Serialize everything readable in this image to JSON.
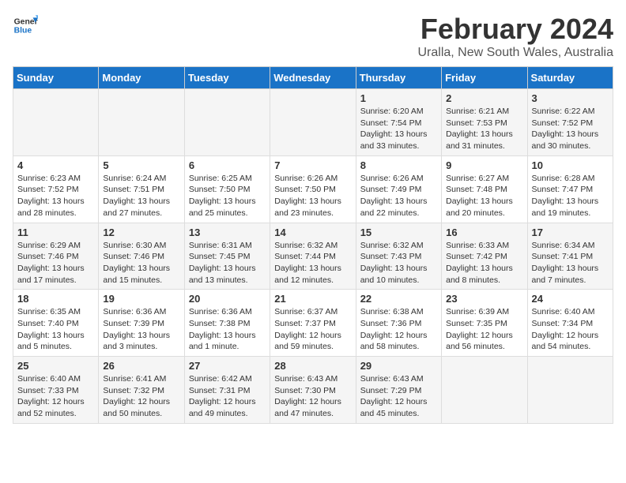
{
  "logo": {
    "line1": "General",
    "line2": "Blue"
  },
  "title": "February 2024",
  "subtitle": "Uralla, New South Wales, Australia",
  "days_header": [
    "Sunday",
    "Monday",
    "Tuesday",
    "Wednesday",
    "Thursday",
    "Friday",
    "Saturday"
  ],
  "weeks": [
    [
      {
        "day": "",
        "info": ""
      },
      {
        "day": "",
        "info": ""
      },
      {
        "day": "",
        "info": ""
      },
      {
        "day": "",
        "info": ""
      },
      {
        "day": "1",
        "info": "Sunrise: 6:20 AM\nSunset: 7:54 PM\nDaylight: 13 hours\nand 33 minutes."
      },
      {
        "day": "2",
        "info": "Sunrise: 6:21 AM\nSunset: 7:53 PM\nDaylight: 13 hours\nand 31 minutes."
      },
      {
        "day": "3",
        "info": "Sunrise: 6:22 AM\nSunset: 7:52 PM\nDaylight: 13 hours\nand 30 minutes."
      }
    ],
    [
      {
        "day": "4",
        "info": "Sunrise: 6:23 AM\nSunset: 7:52 PM\nDaylight: 13 hours\nand 28 minutes."
      },
      {
        "day": "5",
        "info": "Sunrise: 6:24 AM\nSunset: 7:51 PM\nDaylight: 13 hours\nand 27 minutes."
      },
      {
        "day": "6",
        "info": "Sunrise: 6:25 AM\nSunset: 7:50 PM\nDaylight: 13 hours\nand 25 minutes."
      },
      {
        "day": "7",
        "info": "Sunrise: 6:26 AM\nSunset: 7:50 PM\nDaylight: 13 hours\nand 23 minutes."
      },
      {
        "day": "8",
        "info": "Sunrise: 6:26 AM\nSunset: 7:49 PM\nDaylight: 13 hours\nand 22 minutes."
      },
      {
        "day": "9",
        "info": "Sunrise: 6:27 AM\nSunset: 7:48 PM\nDaylight: 13 hours\nand 20 minutes."
      },
      {
        "day": "10",
        "info": "Sunrise: 6:28 AM\nSunset: 7:47 PM\nDaylight: 13 hours\nand 19 minutes."
      }
    ],
    [
      {
        "day": "11",
        "info": "Sunrise: 6:29 AM\nSunset: 7:46 PM\nDaylight: 13 hours\nand 17 minutes."
      },
      {
        "day": "12",
        "info": "Sunrise: 6:30 AM\nSunset: 7:46 PM\nDaylight: 13 hours\nand 15 minutes."
      },
      {
        "day": "13",
        "info": "Sunrise: 6:31 AM\nSunset: 7:45 PM\nDaylight: 13 hours\nand 13 minutes."
      },
      {
        "day": "14",
        "info": "Sunrise: 6:32 AM\nSunset: 7:44 PM\nDaylight: 13 hours\nand 12 minutes."
      },
      {
        "day": "15",
        "info": "Sunrise: 6:32 AM\nSunset: 7:43 PM\nDaylight: 13 hours\nand 10 minutes."
      },
      {
        "day": "16",
        "info": "Sunrise: 6:33 AM\nSunset: 7:42 PM\nDaylight: 13 hours\nand 8 minutes."
      },
      {
        "day": "17",
        "info": "Sunrise: 6:34 AM\nSunset: 7:41 PM\nDaylight: 13 hours\nand 7 minutes."
      }
    ],
    [
      {
        "day": "18",
        "info": "Sunrise: 6:35 AM\nSunset: 7:40 PM\nDaylight: 13 hours\nand 5 minutes."
      },
      {
        "day": "19",
        "info": "Sunrise: 6:36 AM\nSunset: 7:39 PM\nDaylight: 13 hours\nand 3 minutes."
      },
      {
        "day": "20",
        "info": "Sunrise: 6:36 AM\nSunset: 7:38 PM\nDaylight: 13 hours\nand 1 minute."
      },
      {
        "day": "21",
        "info": "Sunrise: 6:37 AM\nSunset: 7:37 PM\nDaylight: 12 hours\nand 59 minutes."
      },
      {
        "day": "22",
        "info": "Sunrise: 6:38 AM\nSunset: 7:36 PM\nDaylight: 12 hours\nand 58 minutes."
      },
      {
        "day": "23",
        "info": "Sunrise: 6:39 AM\nSunset: 7:35 PM\nDaylight: 12 hours\nand 56 minutes."
      },
      {
        "day": "24",
        "info": "Sunrise: 6:40 AM\nSunset: 7:34 PM\nDaylight: 12 hours\nand 54 minutes."
      }
    ],
    [
      {
        "day": "25",
        "info": "Sunrise: 6:40 AM\nSunset: 7:33 PM\nDaylight: 12 hours\nand 52 minutes."
      },
      {
        "day": "26",
        "info": "Sunrise: 6:41 AM\nSunset: 7:32 PM\nDaylight: 12 hours\nand 50 minutes."
      },
      {
        "day": "27",
        "info": "Sunrise: 6:42 AM\nSunset: 7:31 PM\nDaylight: 12 hours\nand 49 minutes."
      },
      {
        "day": "28",
        "info": "Sunrise: 6:43 AM\nSunset: 7:30 PM\nDaylight: 12 hours\nand 47 minutes."
      },
      {
        "day": "29",
        "info": "Sunrise: 6:43 AM\nSunset: 7:29 PM\nDaylight: 12 hours\nand 45 minutes."
      },
      {
        "day": "",
        "info": ""
      },
      {
        "day": "",
        "info": ""
      }
    ]
  ]
}
